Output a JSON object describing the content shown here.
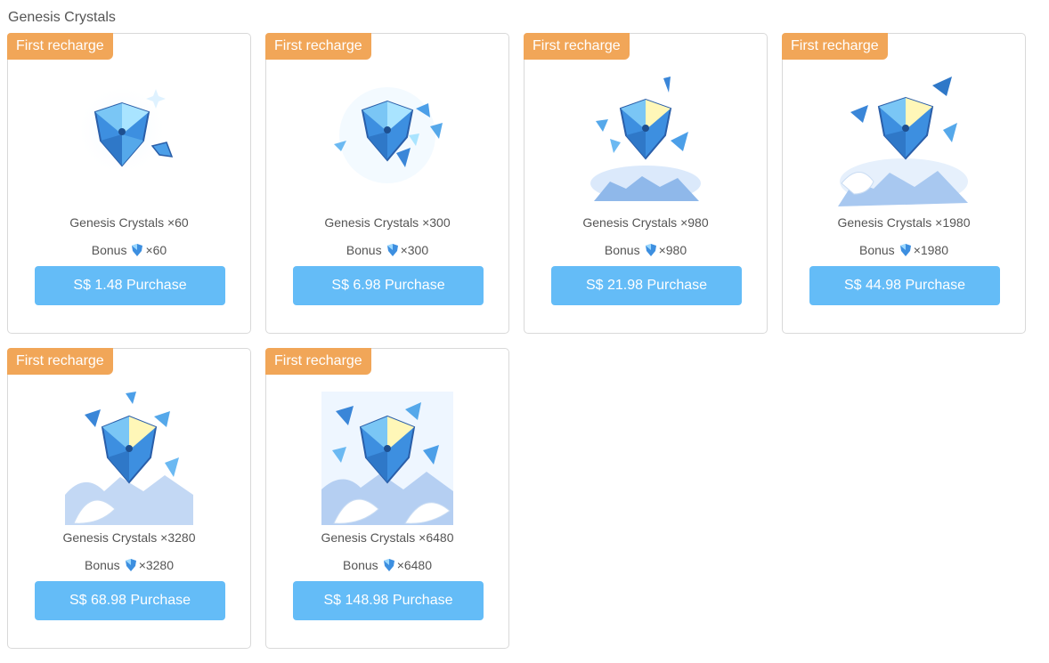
{
  "section": {
    "title": "Genesis Crystals"
  },
  "cards": [
    {
      "tag": "First recharge",
      "name": "Genesis Crystals ×60",
      "bonus_label": "Bonus",
      "bonus_amount": "×60",
      "button": "S$ 1.48 Purchase"
    },
    {
      "tag": "First recharge",
      "name": "Genesis Crystals ×300",
      "bonus_label": "Bonus",
      "bonus_amount": "×300",
      "button": "S$ 6.98 Purchase"
    },
    {
      "tag": "First recharge",
      "name": "Genesis Crystals ×980",
      "bonus_label": "Bonus",
      "bonus_amount": "×980",
      "button": "S$ 21.98 Purchase"
    },
    {
      "tag": "First recharge",
      "name": "Genesis Crystals ×1980",
      "bonus_label": "Bonus",
      "bonus_amount": "×1980",
      "button": "S$ 44.98 Purchase"
    },
    {
      "tag": "First recharge",
      "name": "Genesis Crystals ×3280",
      "bonus_label": "Bonus",
      "bonus_amount": "×3280",
      "button": "S$ 68.98 Purchase"
    },
    {
      "tag": "First recharge",
      "name": "Genesis Crystals ×6480",
      "bonus_label": "Bonus",
      "bonus_amount": "×6480",
      "button": "S$ 148.98 Purchase"
    }
  ],
  "icons": {
    "product_art": "genesis-crystal-icon",
    "bonus_icon": "genesis-crystal-mini-icon"
  },
  "colors": {
    "tag": "#f1a658",
    "button": "#64bcf7",
    "crystal": "#3d8fe0"
  }
}
